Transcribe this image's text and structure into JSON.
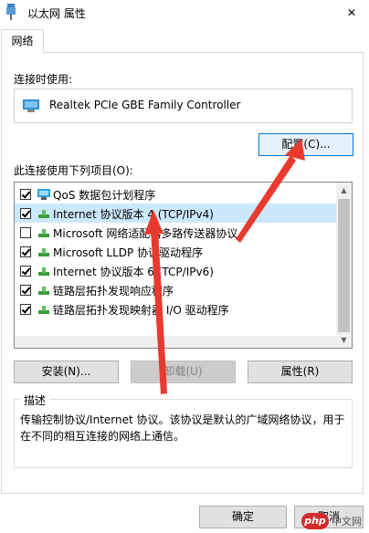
{
  "window": {
    "title": "以太网 属性",
    "close_glyph": "✕"
  },
  "tabs": [
    {
      "label": "网络"
    }
  ],
  "connection": {
    "label": "连接时使用:",
    "adapter_name": "Realtek PCIe GBE Family Controller"
  },
  "buttons": {
    "configure": "配置(C)...",
    "install": "安装(N)...",
    "uninstall": "卸载(U)",
    "properties": "属性(R)",
    "ok": "确定",
    "cancel": "取消"
  },
  "items_label": "此连接使用下列项目(O):",
  "items": [
    {
      "label": "QoS 数据包计划程序",
      "checked": true,
      "icon": "qos-icon"
    },
    {
      "label": "Internet 协议版本 4 (TCP/IPv4)",
      "checked": true,
      "icon": "protocol-icon"
    },
    {
      "label": "Microsoft 网络适配器多路传送器协议",
      "checked": false,
      "icon": "protocol-icon"
    },
    {
      "label": "Microsoft LLDP 协议驱动程序",
      "checked": true,
      "icon": "protocol-icon"
    },
    {
      "label": "Internet 协议版本 6 (TCP/IPv6)",
      "checked": true,
      "icon": "protocol-icon"
    },
    {
      "label": "链路层拓扑发现响应程序",
      "checked": true,
      "icon": "protocol-icon"
    },
    {
      "label": "链路层拓扑发现映射器 I/O 驱动程序",
      "checked": true,
      "icon": "protocol-icon"
    }
  ],
  "description": {
    "title": "描述",
    "text": "传输控制协议/Internet 协议。该协议是默认的广域网络协议，用于在不同的相互连接的网络上通信。"
  },
  "watermark": {
    "logo": "php",
    "text": "中文网"
  },
  "colors": {
    "annotation_arrow": "#e83a2e",
    "selection": "#cce8ff",
    "primary_border": "#0078d7"
  }
}
